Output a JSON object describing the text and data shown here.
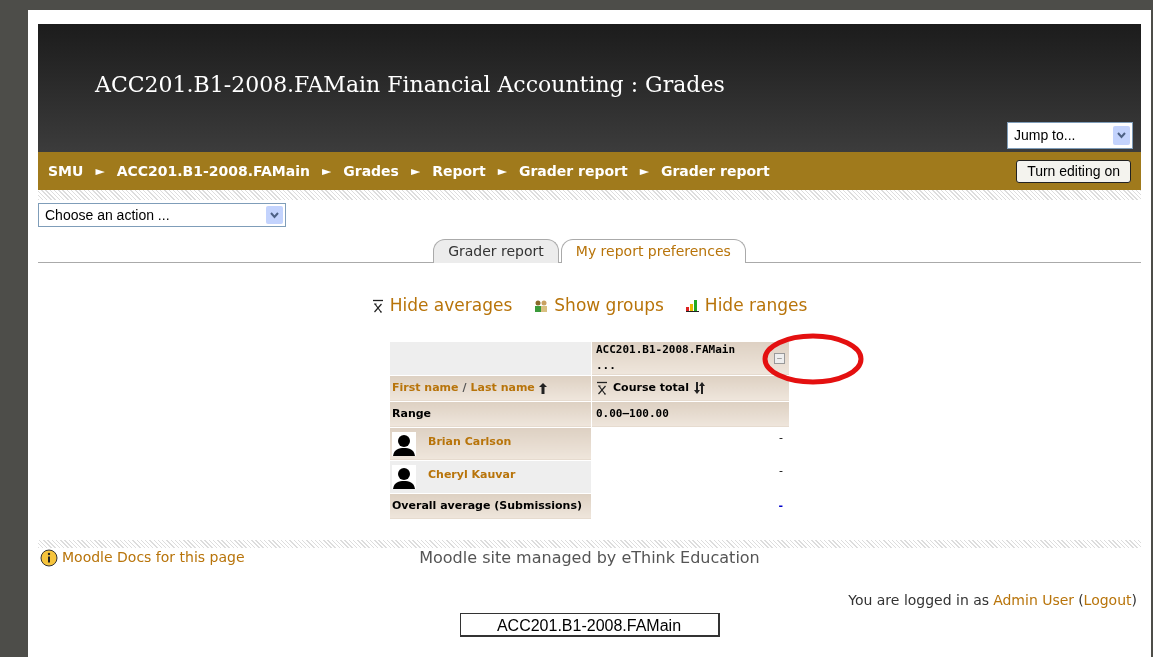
{
  "header": {
    "title": "ACC201.B1-2008.FAMain Financial Accounting : Grades",
    "jump_menu": {
      "value": "Jump to..."
    }
  },
  "breadcrumb": [
    "SMU",
    "ACC201.B1-2008.FAMain",
    "Grades",
    "Report",
    "Grader report",
    "Grader report"
  ],
  "breadcrumb_separator": "►",
  "editing_button": "Turn editing on",
  "action_menu": {
    "value": "Choose an action ..."
  },
  "tabs": [
    {
      "label": "Grader report",
      "selected": true
    },
    {
      "label": "My report preferences",
      "selected": false
    }
  ],
  "toggles": [
    {
      "kind": "averages",
      "label": "Hide averages"
    },
    {
      "kind": "groups",
      "label": "Show groups"
    },
    {
      "kind": "ranges",
      "label": "Hide ranges"
    }
  ],
  "table": {
    "category_header": "ACC201.B1-2008.FAMain ...",
    "collapse_button": "−",
    "first_name": "First name",
    "name_separator": "/",
    "last_name": "Last name",
    "column": "Course total",
    "range_label": "Range",
    "range_value": "0.00–100.00",
    "rows": [
      {
        "name": "Brian Carlson",
        "value": "-"
      },
      {
        "name": "Cheryl Kauvar",
        "value": "-"
      }
    ],
    "average_label": "Overall average (Submissions)",
    "average_value": "-"
  },
  "footer": {
    "docs_link": "Moodle Docs for this page",
    "managed_by": "Moodle site managed by eThink Education",
    "login_prefix": "You are logged in as",
    "user": "Admin User",
    "logout_open": "(",
    "logout": "Logout",
    "logout_close": ")",
    "course_button": "ACC201.B1-2008.FAMain"
  },
  "annotation": {
    "kind": "circle"
  }
}
